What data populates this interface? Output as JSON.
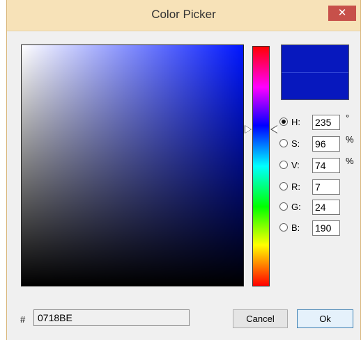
{
  "window": {
    "title": "Color Picker",
    "close_glyph": "✕"
  },
  "colors": {
    "current": "#0718BE",
    "previous": "#0718BE",
    "hue_pure": "#0016FF"
  },
  "fields": {
    "h": {
      "label": "H:",
      "value": "235",
      "unit": "°",
      "selected": true
    },
    "s": {
      "label": "S:",
      "value": "96",
      "unit": "%",
      "selected": false
    },
    "v": {
      "label": "V:",
      "value": "74",
      "unit": "%",
      "selected": false
    },
    "r": {
      "label": "R:",
      "value": "7",
      "selected": false
    },
    "g": {
      "label": "G:",
      "value": "24",
      "selected": false
    },
    "b": {
      "label": "B:",
      "value": "190",
      "selected": false
    }
  },
  "hex": {
    "prefix": "#",
    "value": "0718BE"
  },
  "buttons": {
    "cancel": "Cancel",
    "ok": "Ok"
  }
}
